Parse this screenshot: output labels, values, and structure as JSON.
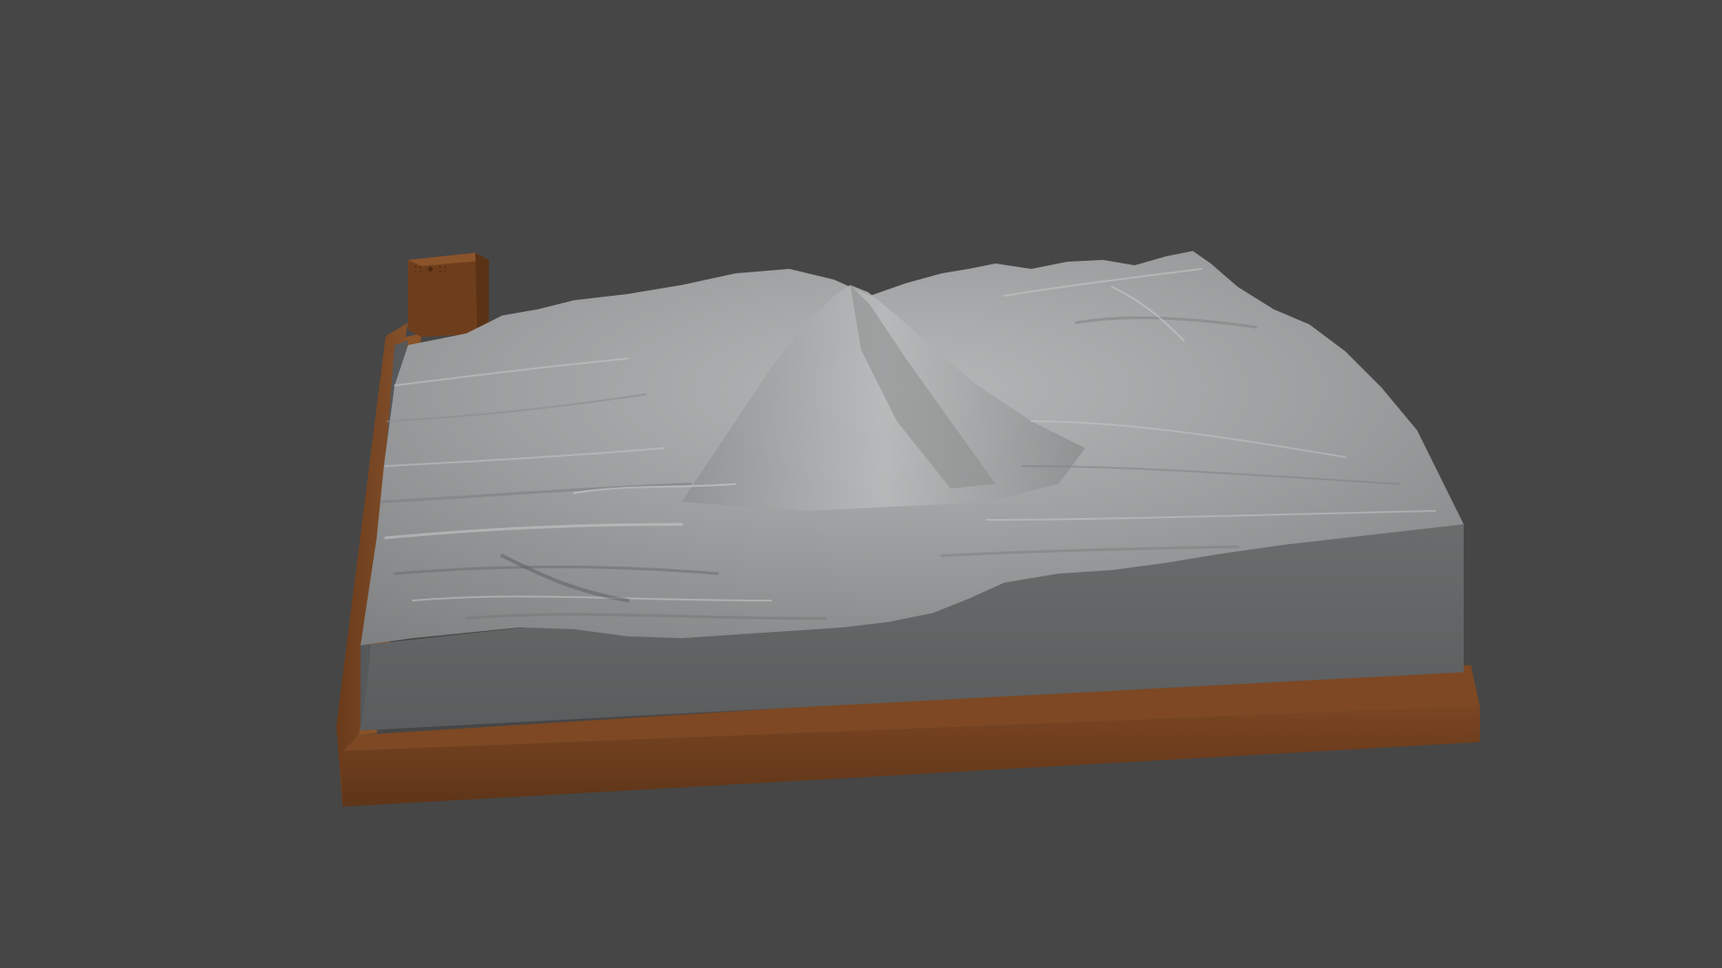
{
  "scene": {
    "background_color": "#464646",
    "model": {
      "base_color": "#6b3e1f",
      "base_top_color": "#804a25",
      "terrain_color": "#9a9c9d",
      "terrain_side_color": "#5f6162",
      "label_block_color": "#76431f",
      "label_block_text": "∷ ✦ ∷"
    }
  }
}
